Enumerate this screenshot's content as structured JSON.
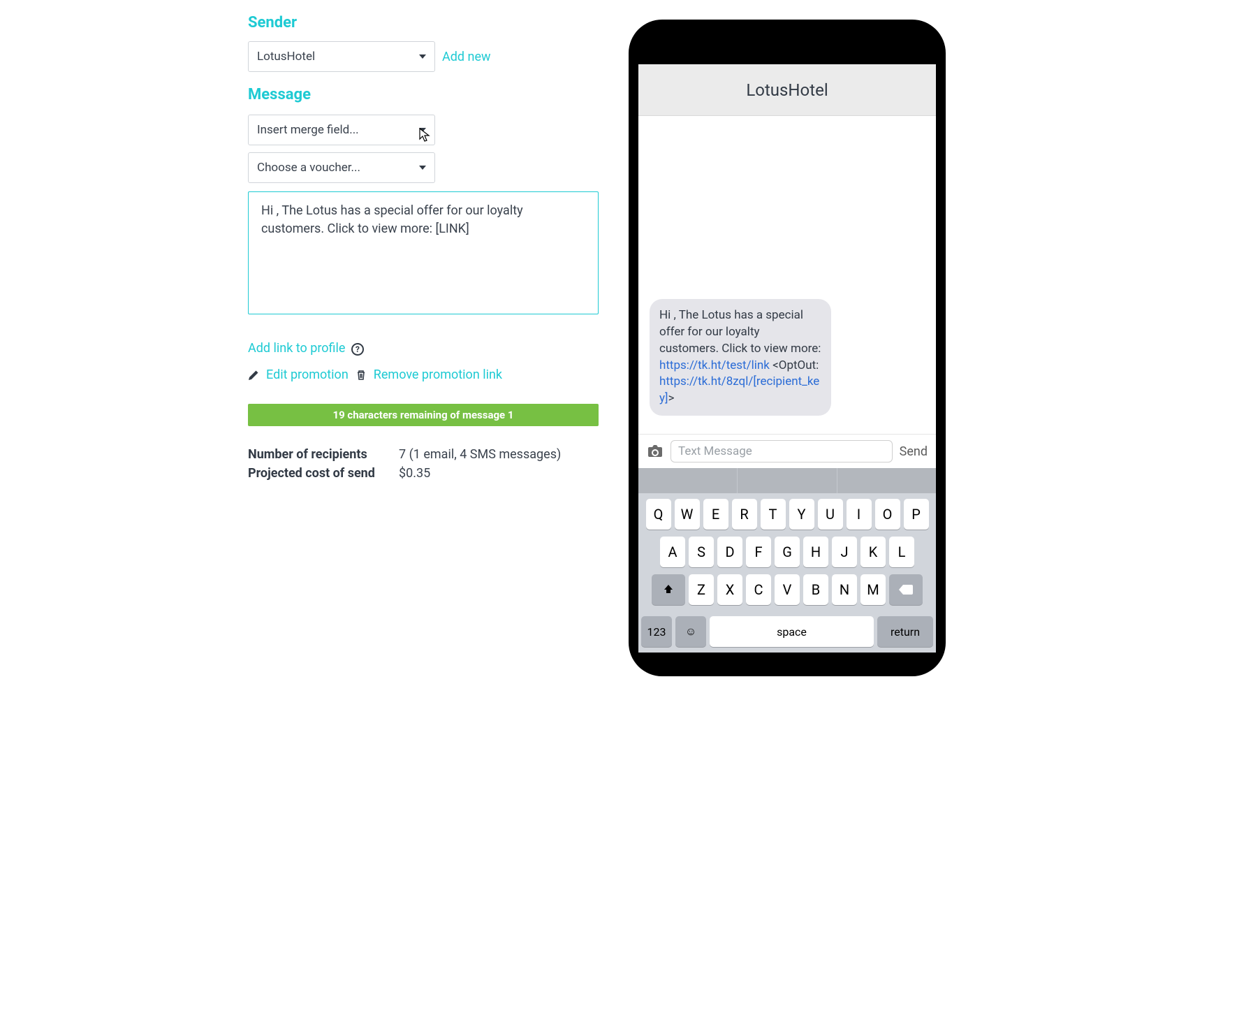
{
  "sender": {
    "title": "Sender",
    "selected": "LotusHotel",
    "add_new": "Add new"
  },
  "message": {
    "title": "Message",
    "merge_placeholder": "Insert merge field...",
    "voucher_placeholder": "Choose a voucher...",
    "body": "Hi , The Lotus has a special offer for our loyalty customers. Click to view more: [LINK]",
    "add_link_profile": "Add link to profile",
    "edit_promotion": "Edit promotion",
    "remove_promotion": "Remove promotion link",
    "counter": "19 characters remaining of message 1"
  },
  "stats": {
    "recipients_label": "Number of recipients",
    "recipients_value": "7 (1 email, 4 SMS messages)",
    "cost_label": "Projected cost of send",
    "cost_value": "$0.35"
  },
  "preview": {
    "sender_name": "LotusHotel",
    "bubble_text_pre": "Hi , The Lotus has a special offer for our loyalty customers. Click to view more: ",
    "bubble_link1": "https://tk.ht/test/link",
    "bubble_mid": "<OptOut: ",
    "bubble_link2": "https://tk.ht/8zql/[recipient_key]",
    "bubble_end": ">",
    "input_placeholder": "Text Message",
    "send_label": "Send",
    "keys_row1": [
      "Q",
      "W",
      "E",
      "R",
      "T",
      "Y",
      "U",
      "I",
      "O",
      "P"
    ],
    "keys_row2": [
      "A",
      "S",
      "D",
      "F",
      "G",
      "H",
      "J",
      "K",
      "L"
    ],
    "keys_row3": [
      "Z",
      "X",
      "C",
      "V",
      "B",
      "N",
      "M"
    ],
    "k123": "123",
    "space": "space",
    "return": "return"
  }
}
